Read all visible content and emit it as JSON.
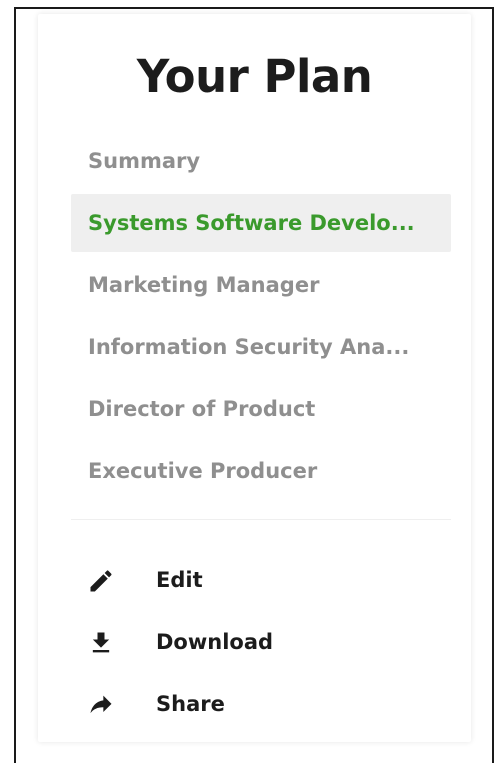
{
  "plan": {
    "title": "Your Plan",
    "nav_items": [
      {
        "label": "Summary",
        "active": false
      },
      {
        "label": "Systems Software Develo...",
        "active": true
      },
      {
        "label": "Marketing Manager",
        "active": false
      },
      {
        "label": "Information Security Ana...",
        "active": false
      },
      {
        "label": "Director of Product",
        "active": false
      },
      {
        "label": "Executive Producer",
        "active": false
      }
    ],
    "actions": [
      {
        "label": "Edit",
        "icon": "pencil-icon"
      },
      {
        "label": "Download",
        "icon": "download-icon"
      },
      {
        "label": "Share",
        "icon": "share-arrow-icon"
      }
    ]
  },
  "colors": {
    "active_text": "#3a9a2c",
    "active_background": "#efefef",
    "inactive_text": "#8f8f8f",
    "dark_text": "#1c1c1c"
  }
}
